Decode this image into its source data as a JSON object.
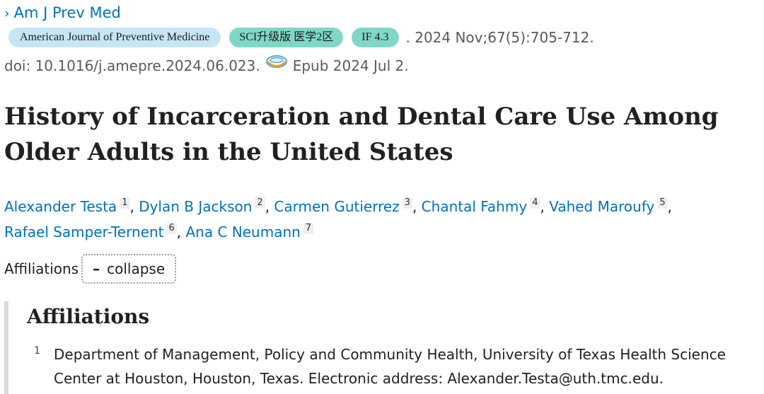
{
  "journal": {
    "link_label": "Am J Prev Med",
    "chevron_glyph": "›",
    "full_name": "American Journal of Preventive Medicine",
    "sci_badge": "SCI升级版 医学2区",
    "if_badge": "IF 4.3",
    "citation": ". 2024 Nov;67(5):705-712.",
    "doi": "doi: 10.1016/j.amepre.2024.06.023.",
    "epub": "Epub 2024 Jul 2.",
    "epub_icon": "free-pmc-icon"
  },
  "title": "History of Incarceration and Dental Care Use Among Older Adults in the United States",
  "authors": [
    {
      "name": "Alexander Testa",
      "ref": "1"
    },
    {
      "name": "Dylan B Jackson",
      "ref": "2"
    },
    {
      "name": "Carmen Gutierrez",
      "ref": "3"
    },
    {
      "name": "Chantal Fahmy",
      "ref": "4"
    },
    {
      "name": "Vahed Maroufy",
      "ref": "5"
    },
    {
      "name": "Rafael Samper-Ternent",
      "ref": "6"
    },
    {
      "name": "Ana C Neumann",
      "ref": "7"
    }
  ],
  "affiliations_toggle": {
    "label": "Affiliations",
    "button_symbol": "–",
    "button_label": "collapse"
  },
  "affiliations": {
    "heading": "Affiliations",
    "items": [
      {
        "num": "1",
        "text": "Department of Management, Policy and Community Health, University of Texas Health Science Center at Houston, Houston, Texas. Electronic address: Alexander.Testa@uth.tmc.edu."
      }
    ]
  },
  "colors": {
    "link": "#0071bc",
    "journal_pill": "#c6e6f5",
    "badge_teal": "#7fd8c7"
  }
}
